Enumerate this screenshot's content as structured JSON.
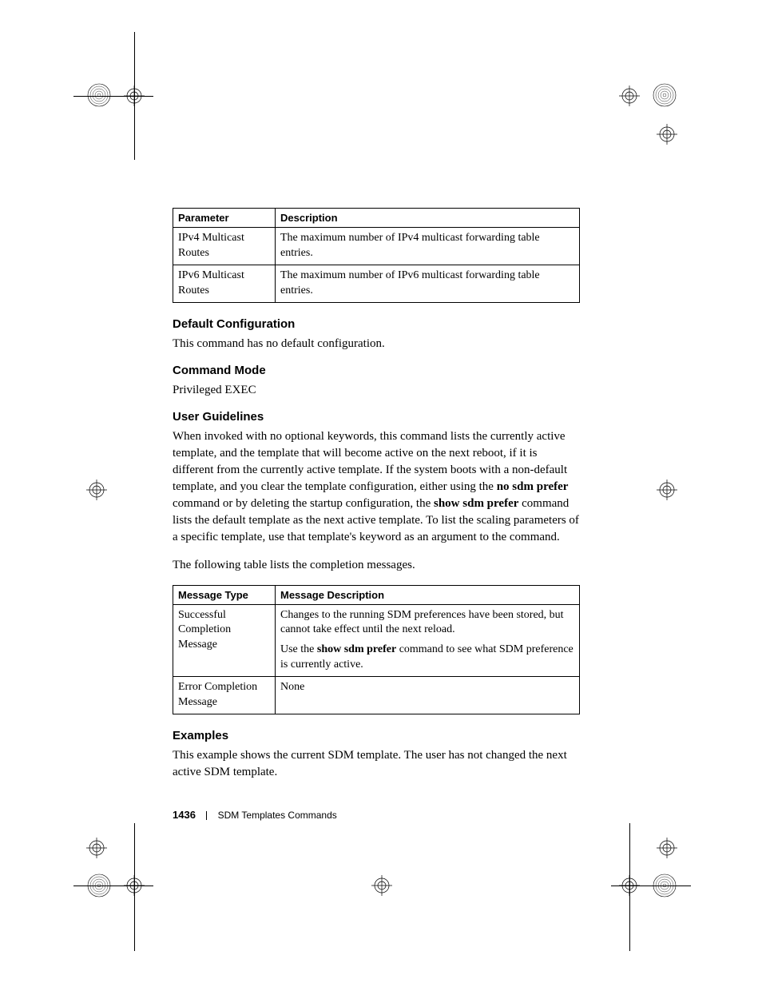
{
  "table1": {
    "headers": [
      "Parameter",
      "Description"
    ],
    "rows": [
      [
        "IPv4 Multicast Routes",
        "The maximum number of IPv4 multicast forwarding table entries."
      ],
      [
        "IPv6 Multicast Routes",
        "The maximum number of IPv6 multicast forwarding table entries."
      ]
    ]
  },
  "sections": {
    "default_config": {
      "heading": "Default Configuration",
      "body": "This command has no default configuration."
    },
    "command_mode": {
      "heading": "Command Mode",
      "body": "Privileged EXEC"
    },
    "user_guidelines": {
      "heading": "User Guidelines",
      "p1_a": "When invoked with no optional keywords, this command lists the currently active template, and the template that will become active on the next reboot, if it is different from the currently active template. If the system boots with a non-default template, and you clear the template configuration, either using the ",
      "p1_b": "no sdm prefer",
      "p1_c": " command or by deleting the startup configuration, the ",
      "p1_d": "show sdm prefer",
      "p1_e": " command lists the default template as the next active template. To list the scaling parameters of a specific template, use that template's keyword as an argument to the command.",
      "p2": "The following table lists the completion messages."
    },
    "examples": {
      "heading": "Examples",
      "body": "This example shows the current SDM template. The user has not changed the next active SDM template."
    }
  },
  "table2": {
    "headers": [
      "Message Type",
      "Message Description"
    ],
    "rows": [
      {
        "c0": "Successful Completion Message",
        "c1a": "Changes to the running SDM preferences have been stored, but cannot take effect until the next reload.",
        "c1b_a": "Use the ",
        "c1b_b": "show sdm prefer",
        "c1b_c": " command to see what SDM preference is currently active."
      },
      {
        "c0": "Error Completion Message",
        "c1": "None"
      }
    ]
  },
  "footer": {
    "page": "1436",
    "section": "SDM Templates Commands"
  }
}
